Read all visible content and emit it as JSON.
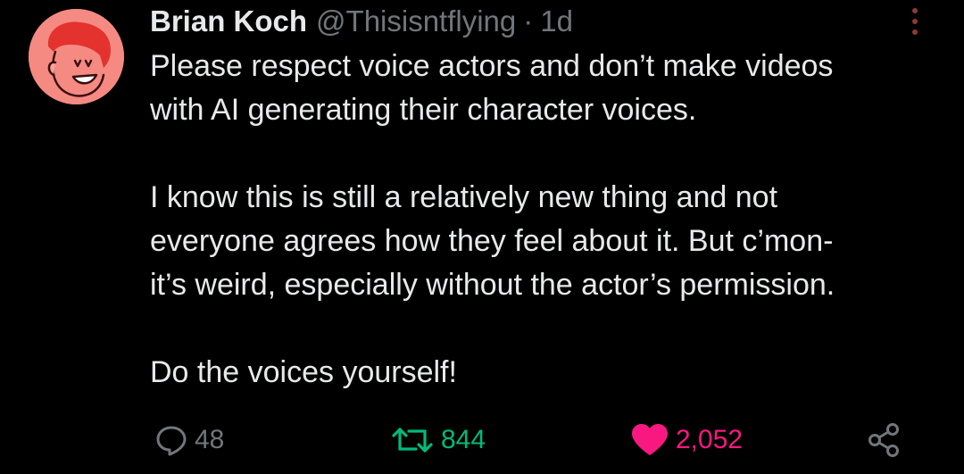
{
  "tweet": {
    "author": {
      "display_name": "Brian Koch",
      "handle": "@Thisisntflying",
      "separator": "·",
      "time": "1d"
    },
    "paragraphs": [
      "Please respect voice actors and don’t make videos\nwith AI generating their character voices.",
      "I know this is still a relatively new thing and not\neveryone agrees how they feel about it. But c’mon-\nit’s weird, especially without the actor’s permission.",
      "Do the voices yourself!"
    ],
    "stats": {
      "replies": "48",
      "retweets": "844",
      "likes": "2,052"
    },
    "liked": true
  },
  "colors": {
    "background": "#000000",
    "text": "#e7e9ea",
    "muted": "#71767b",
    "retweet": "#00ba7c",
    "like": "#f91880",
    "avatar_bg": "#f58a82",
    "more_dots": "#8b3a3a"
  },
  "icons": {
    "reply": "speech-bubble-icon",
    "retweet": "retweet-arrows-icon",
    "like": "heart-icon",
    "share": "share-nodes-icon",
    "more": "vertical-dots-icon"
  }
}
